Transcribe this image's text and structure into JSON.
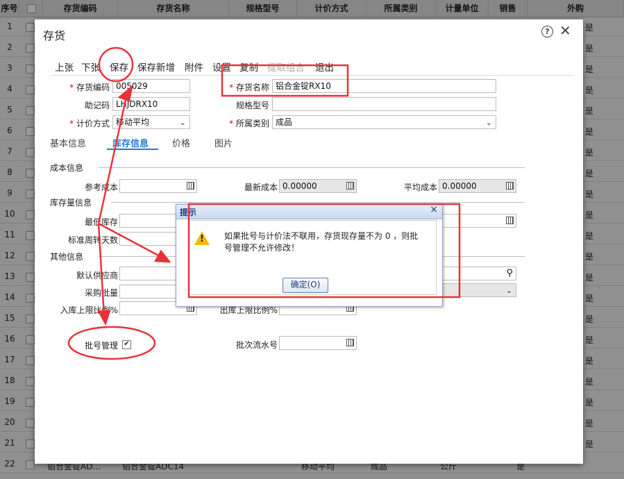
{
  "grid": {
    "headers": [
      "序号",
      "存货编码",
      "存货名称",
      "规格型号",
      "计价方式",
      "所属类别",
      "计量单位",
      "销售",
      "外购"
    ],
    "rows": [
      "1",
      "2",
      "3",
      "4",
      "5",
      "6",
      "7",
      "8",
      "9",
      "10",
      "11",
      "12",
      "13",
      "14",
      "15",
      "16",
      "17",
      "18",
      "19",
      "20",
      "21",
      "22"
    ],
    "yes": "是",
    "last_row": {
      "code": "铝合金锭AD...",
      "name": "铝合金锭ADC14",
      "method": "移动平均",
      "category": "成品",
      "unit": "公斤",
      "sale": "是"
    }
  },
  "dialog": {
    "title": "存货",
    "toolbar": [
      "上张",
      "下张",
      "保存",
      "保存新增",
      "附件",
      "设置",
      "复制",
      "提取组合",
      "退出"
    ],
    "fields": {
      "code_label": "存货编码",
      "code_value": "005029",
      "name_label": "存货名称",
      "name_value": "铝合金锭RX10",
      "mnemonic_label": "助记码",
      "mnemonic_value": "LHJDRX10",
      "spec_label": "规格型号",
      "spec_value": "",
      "pricing_label": "计价方式",
      "pricing_value": "移动平均",
      "category_label": "所属类别",
      "category_value": "成品"
    },
    "tabs": [
      "基本信息",
      "库存信息",
      "价格",
      "图片"
    ],
    "active_tab": "库存信息",
    "cost": {
      "header": "成本信息",
      "ref_cost_label": "参考成本",
      "ref_cost_value": "",
      "latest_cost_label": "最新成本",
      "latest_cost_value": "0.00000",
      "avg_cost_label": "平均成本",
      "avg_cost_value": "0.00000"
    },
    "stock": {
      "header": "库存量信息",
      "min_stock_label": "最低库存",
      "turnover_label": "标准周转天数"
    },
    "other": {
      "header": "其他信息",
      "supplier_label": "默认供应商",
      "purchase_batch_label": "采购批量",
      "in_limit_label": "入库上限比例%",
      "out_limit_label": "出库上限比例%",
      "batch_mgmt_label": "批号管理",
      "batch_mgmt_checked": "✔",
      "serial_label": "批次流水号"
    }
  },
  "alert": {
    "title": "提示",
    "message": "如果批号与计价法不联用，存货现存量不为 0 ，则批号管理不允许修改！",
    "ok_label": "确定(O)"
  },
  "colors": {
    "annotation": "#e8323a",
    "accent": "#1f7ad6",
    "warning": "#f2b90f"
  }
}
